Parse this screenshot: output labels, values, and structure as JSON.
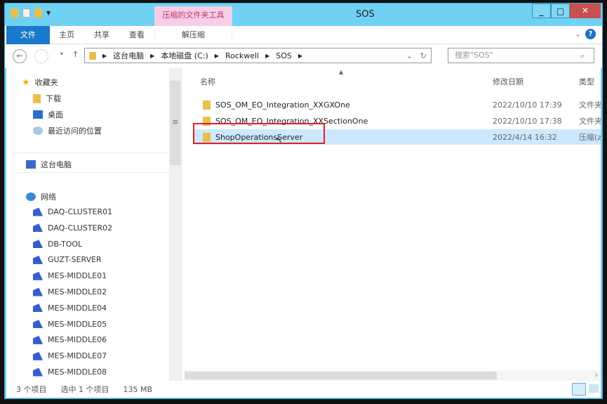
{
  "window": {
    "title": "SOS",
    "context_tab": "压缩的文件夹工具"
  },
  "ribbon": {
    "tabs": [
      "文件",
      "主页",
      "共享",
      "查看",
      "解压缩"
    ]
  },
  "address": {
    "crumbs": [
      "这台电脑",
      "本地磁盘 (C:)",
      "Rockwell",
      "SOS"
    ],
    "search_placeholder": "搜索\"SOS\""
  },
  "nav": {
    "favorites": "收藏夹",
    "items": [
      "下载",
      "桌面",
      "最近访问的位置"
    ],
    "this_pc": "这台电脑",
    "network": "网络",
    "computers": [
      "DAQ-CLUSTER01",
      "DAQ-CLUSTER02",
      "DB-TOOL",
      "GUZT-SERVER",
      "MES-MIDDLE01",
      "MES-MIDDLE02",
      "MES-MIDDLE04",
      "MES-MIDDLE05",
      "MES-MIDDLE06",
      "MES-MIDDLE07",
      "MES-MIDDLE08"
    ]
  },
  "columns": {
    "name": "名称",
    "date": "修改日期",
    "type": "类型"
  },
  "files": [
    {
      "name": "SOS_OM_EO_Integration_XXGXOne",
      "date": "2022/10/10 17:39",
      "type": "文件夹"
    },
    {
      "name": "SOS_OM_EO_Integration_XXSectionOne",
      "date": "2022/10/10 17:38",
      "type": "文件夹"
    },
    {
      "name": "ShopOperationsServer",
      "date": "2022/4/14 16:32",
      "type": "压缩(zipped)文件夹"
    }
  ],
  "status": {
    "count": "3 个项目",
    "selected": "选中 1 个项目",
    "size": "135 MB"
  },
  "colors": {
    "titlebar": "#6fd2f4",
    "file_tab": "#1979ca",
    "selection": "#cce8ff",
    "highlight_box": "#e0202a"
  }
}
